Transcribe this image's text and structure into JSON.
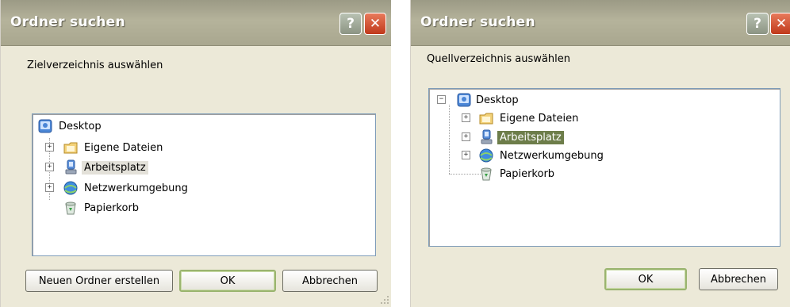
{
  "left_dialog": {
    "title": "Ordner suchen",
    "prompt": "Zielverzeichnis auswählen",
    "tree": {
      "root": "Desktop",
      "items": [
        "Eigene Dateien",
        "Arbeitsplatz",
        "Netzwerkumgebung",
        "Papierkorb"
      ],
      "selected": "Arbeitsplatz"
    },
    "buttons": {
      "new_folder": "Neuen Ordner erstellen",
      "ok": "OK",
      "cancel": "Abbrechen"
    }
  },
  "right_dialog": {
    "title": "Ordner suchen",
    "prompt": "Quellverzeichnis auswählen",
    "tree": {
      "root": "Desktop",
      "items": [
        "Eigene Dateien",
        "Arbeitsplatz",
        "Netzwerkumgebung",
        "Papierkorb"
      ],
      "selected": "Arbeitsplatz"
    },
    "buttons": {
      "ok": "OK",
      "cancel": "Abbrechen"
    }
  },
  "icons": {
    "help": "?",
    "close": "✕",
    "expand": "+",
    "collapse": "−"
  },
  "colors": {
    "dialog_bg": "#ece9d8",
    "titlebar": "#b5b39b",
    "selection_right": "#6d7d4a",
    "close_button": "#c0391b"
  }
}
